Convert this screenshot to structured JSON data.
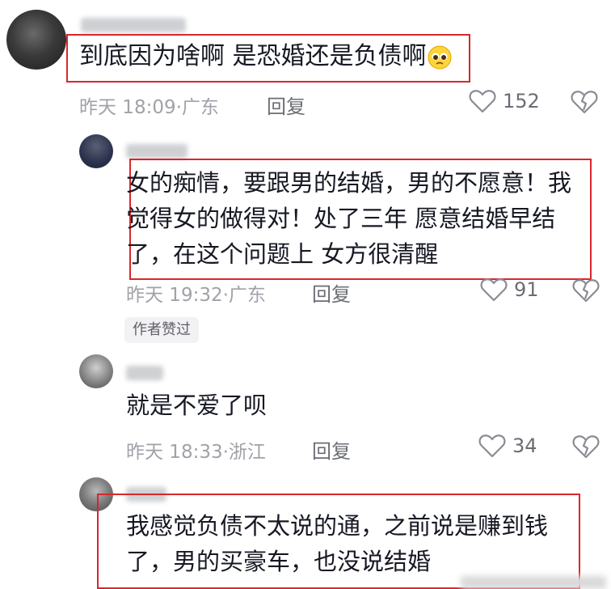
{
  "comments": [
    {
      "text": "到底因为啥啊 是恐婚还是负债啊",
      "emoji": "pleading-face",
      "time": "昨天 18:09",
      "location": "广东",
      "reply_label": "回复",
      "likes": "152"
    },
    {
      "lines": [
        "女的痴情，要跟男的结婚，男的不愿意！我",
        "觉得女的做得对！处了三年 愿意结婚早结",
        "了，在这个问题上 女方很清醒"
      ],
      "time": "昨天 19:32",
      "location": "广东",
      "reply_label": "回复",
      "likes": "91",
      "badge": "作者赞过"
    },
    {
      "text": "就是不爱了呗",
      "time": "昨天 18:33",
      "location": "浙江",
      "reply_label": "回复",
      "likes": "34"
    },
    {
      "lines": [
        "我感觉负债不太说的通，之前说是赚到钱",
        "了，男的买豪车，也没说结婚"
      ]
    }
  ],
  "icons": {
    "like": "heart-outline-icon",
    "dislike": "broken-heart-icon"
  },
  "colors": {
    "highlight": "#d8272b",
    "text": "#161823",
    "meta": "#a0a2a8"
  }
}
